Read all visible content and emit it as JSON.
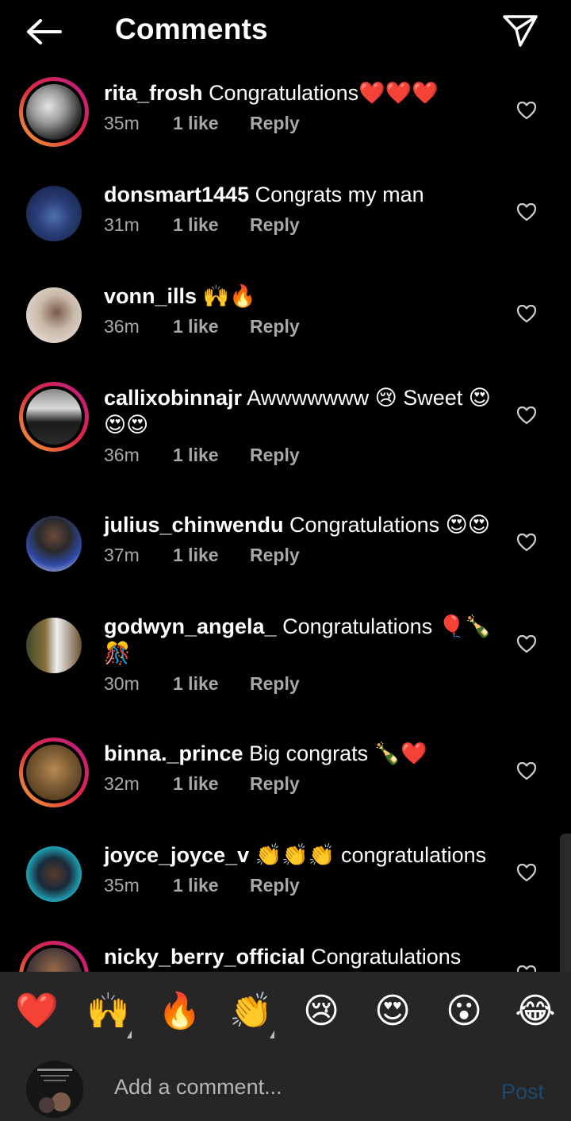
{
  "header": {
    "title": "Comments",
    "back_icon": "back-arrow-icon",
    "share_icon": "paper-plane-icon"
  },
  "comments": [
    {
      "user": "rita_frosh",
      "text": "Congratulations❤️❤️❤️",
      "time": "35m",
      "likes": "1 like",
      "reply": "Reply",
      "ring": true
    },
    {
      "user": "donsmart1445",
      "text": "Congrats my man",
      "time": "31m",
      "likes": "1 like",
      "reply": "Reply",
      "ring": false
    },
    {
      "user": "vonn_ills",
      "text": "🙌🔥",
      "time": "36m",
      "likes": "1 like",
      "reply": "Reply",
      "ring": false
    },
    {
      "user": "callixobinnajr",
      "text": "Awwwwwww 😢 Sweet 😍😍😍",
      "time": "36m",
      "likes": "1 like",
      "reply": "Reply",
      "ring": true
    },
    {
      "user": "julius_chinwendu",
      "text": "Congratulations 😍😍",
      "time": "37m",
      "likes": "1 like",
      "reply": "Reply",
      "ring": false
    },
    {
      "user": "godwyn_angela_",
      "text": "Congratulations 🎈🍾🎊",
      "time": "30m",
      "likes": "1 like",
      "reply": "Reply",
      "ring": false
    },
    {
      "user": "binna._prince",
      "text": "Big congrats 🍾❤️",
      "time": "32m",
      "likes": "1 like",
      "reply": "Reply",
      "ring": true
    },
    {
      "user": "joyce_joyce_v",
      "text": "👏👏👏 congratulations",
      "time": "35m",
      "likes": "1 like",
      "reply": "Reply",
      "ring": false
    },
    {
      "user": "nicky_berry_official",
      "text": "Congratulations hon",
      "time": "",
      "likes": "",
      "reply": "",
      "ring": true
    }
  ],
  "emoji_bar": [
    "❤️",
    "🙌",
    "🔥",
    "👏",
    "😢",
    "😍",
    "😮",
    "😂"
  ],
  "composer": {
    "placeholder": "Add a comment...",
    "post_label": "Post"
  },
  "colors": {
    "background": "#000000",
    "panel": "#262626",
    "muted_text": "#a8a8a8",
    "post_disabled": "#1c4a6e"
  }
}
